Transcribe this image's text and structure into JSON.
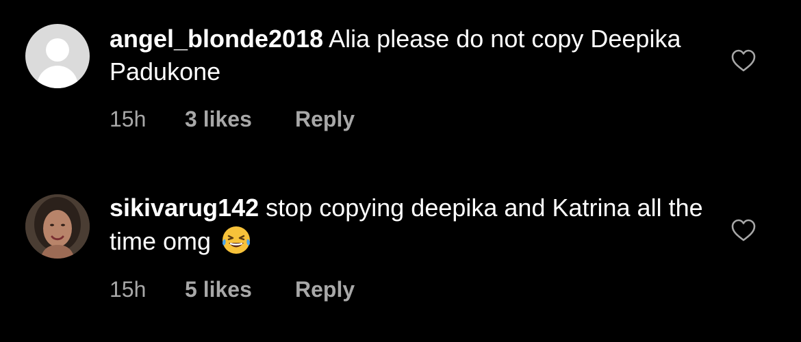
{
  "comments": [
    {
      "username": "angel_blonde2018",
      "text": "Alia please do not copy Deepika Padukone",
      "time": "15h",
      "likes": "3 likes",
      "reply_label": "Reply",
      "avatar": "default-avatar"
    },
    {
      "username": "sikivarug142",
      "text": "stop copying deepika and Katrina all the time omg",
      "emoji": "😂",
      "time": "15h",
      "likes": "5 likes",
      "reply_label": "Reply",
      "avatar": "photo-avatar"
    }
  ],
  "icons": {
    "like": "heart-outline-icon",
    "emoji": "face-with-tears-of-joy"
  },
  "colors": {
    "background": "#000000",
    "text": "#ffffff",
    "secondary_text": "#a8a8a8",
    "default_avatar": "#dbdbdb"
  }
}
